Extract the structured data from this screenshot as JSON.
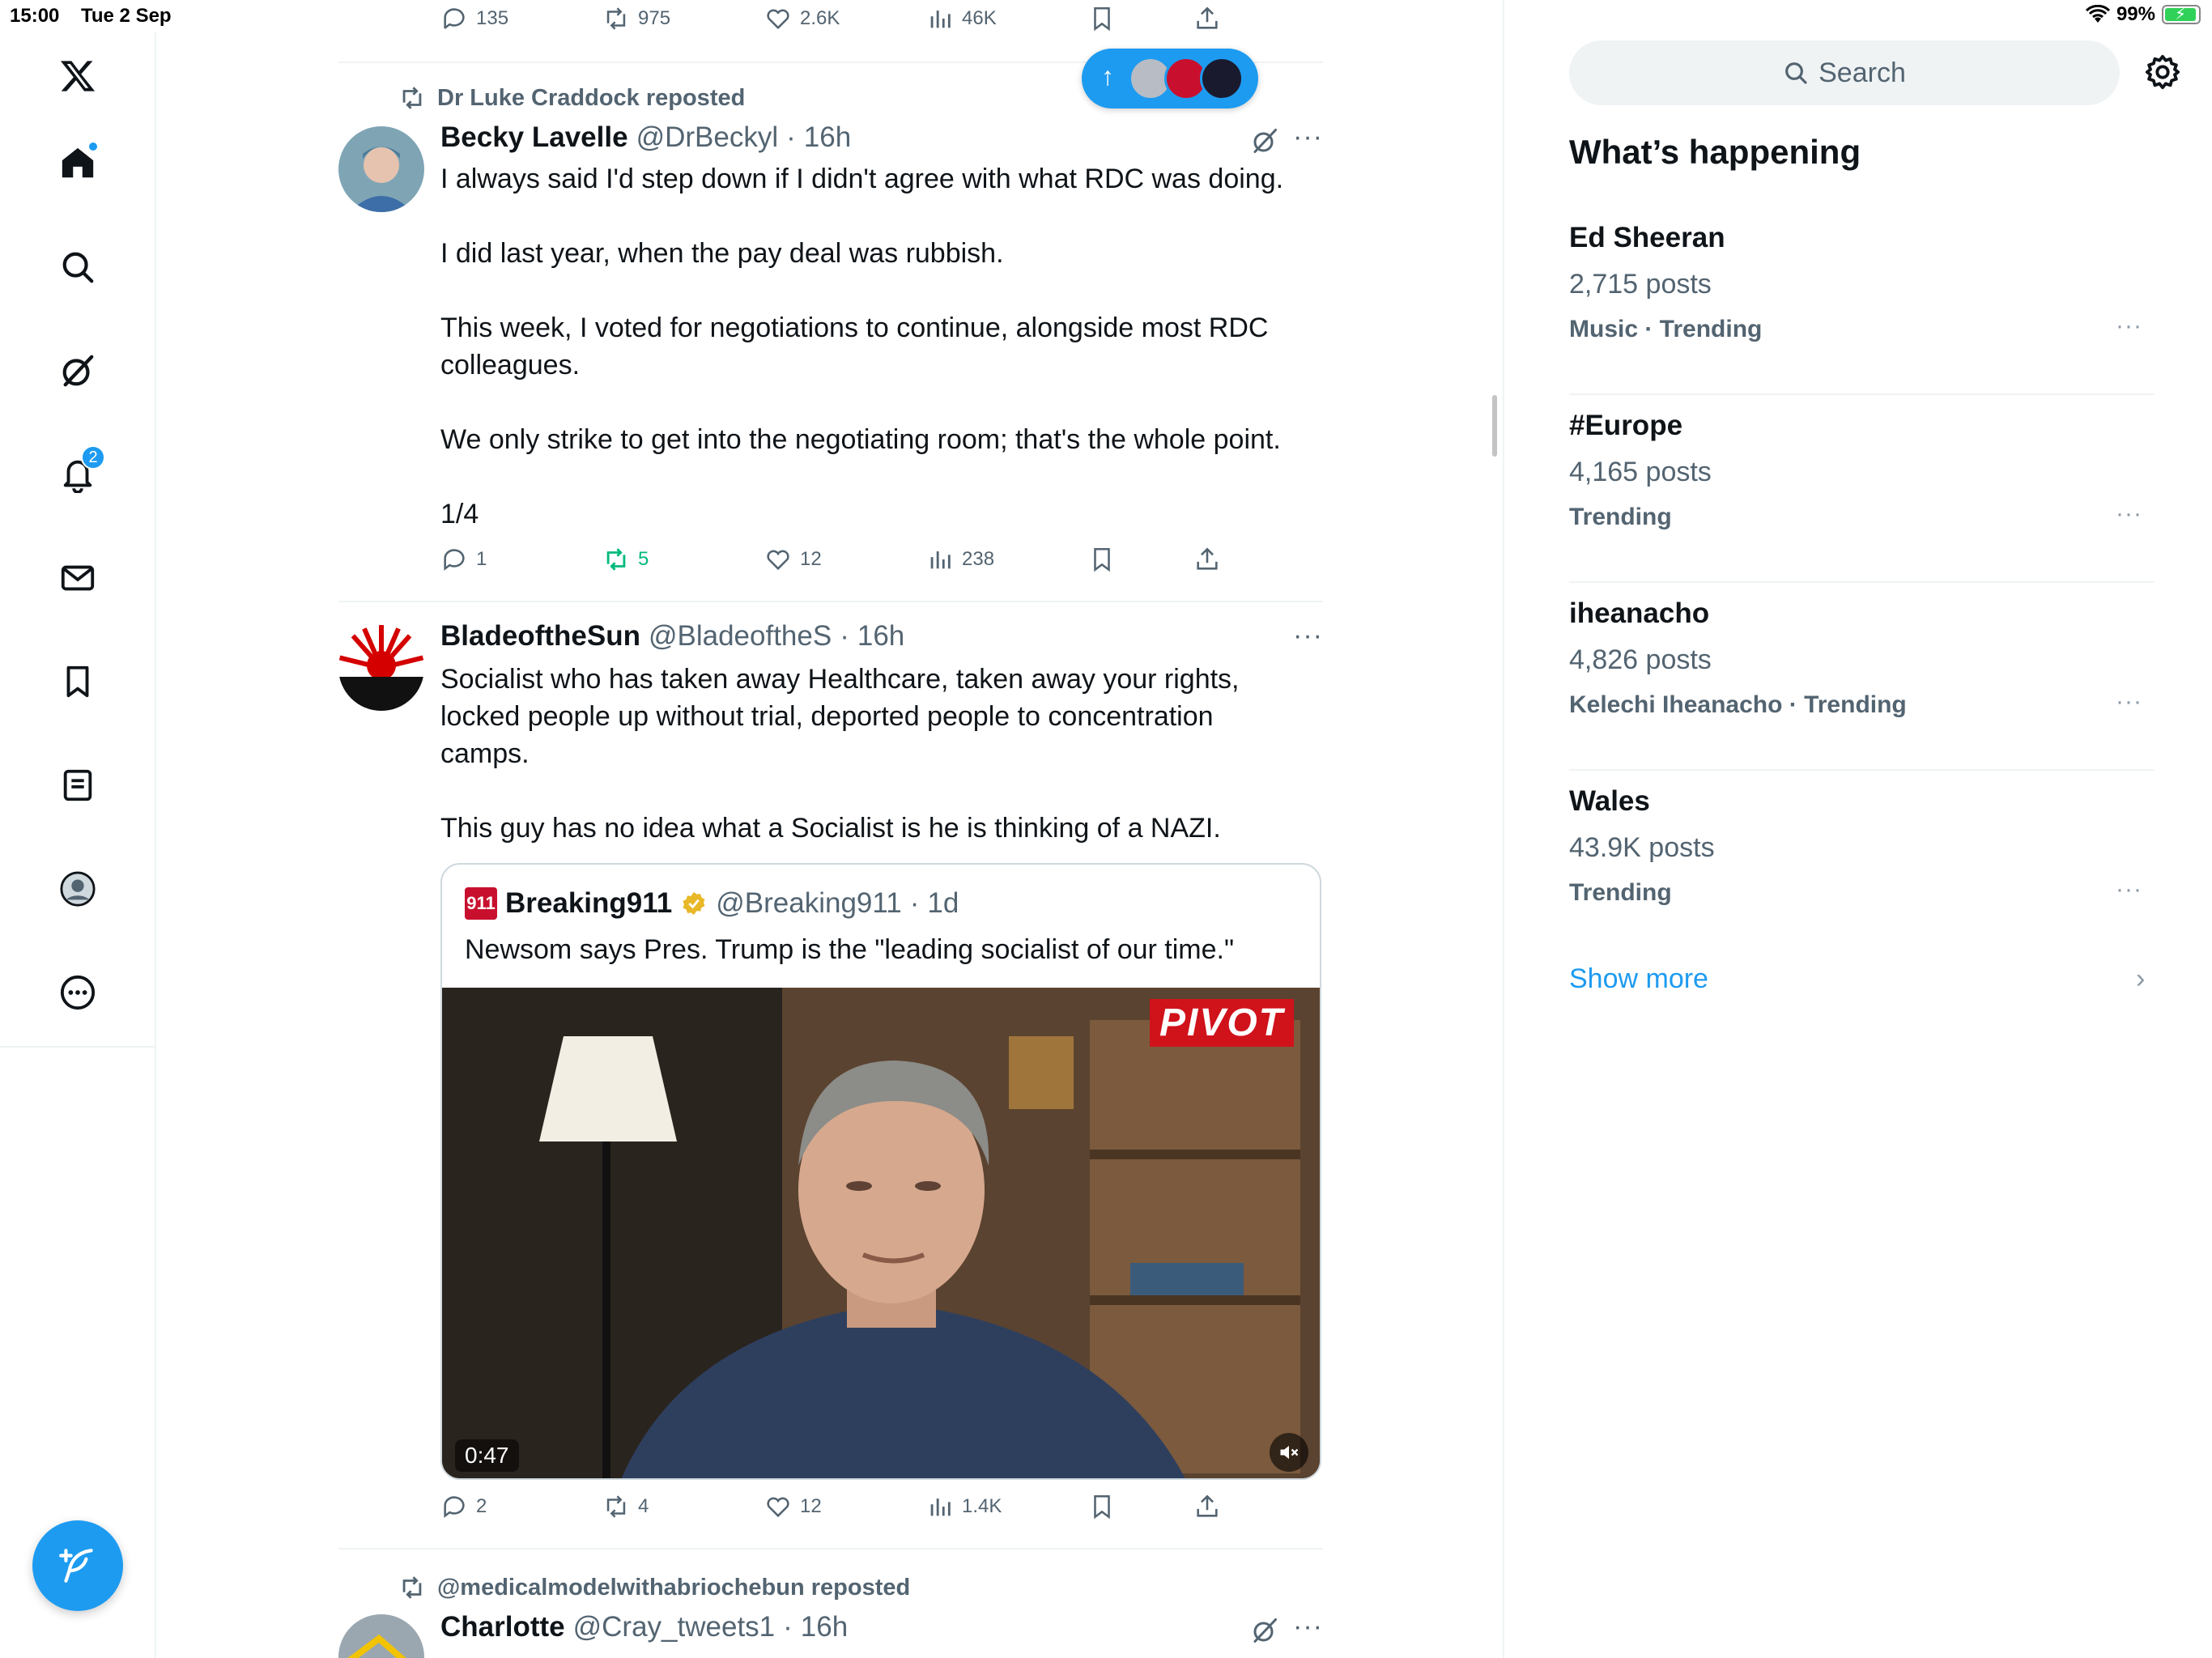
{
  "status_bar": {
    "time": "15:00",
    "date": "Tue 2 Sep",
    "battery": "99%"
  },
  "nav": {
    "notifications_badge": "2",
    "items": [
      "home",
      "explore",
      "grok",
      "notifications",
      "messages",
      "bookmarks",
      "lists",
      "profile",
      "more"
    ]
  },
  "feed": {
    "new_posts_pill_arrow": "↑",
    "top_actions": {
      "replies": "135",
      "reposts": "975",
      "likes": "2.6K",
      "views": "46K"
    },
    "post1": {
      "reposted_by": "Dr Luke Craddock reposted",
      "name": "Becky Lavelle",
      "handle": "@DrBeckyl",
      "dot": "·",
      "time": "16h",
      "text": "I always said I'd step down if I didn't agree with what RDC was doing.\n\nI did last year, when the pay deal was rubbish.\n\nThis week, I voted for negotiations to continue, alongside most RDC colleagues.\n\nWe only strike to get into the negotiating room; that's the whole point.\n\n1/4",
      "replies": "1",
      "reposts": "5",
      "likes": "12",
      "views": "238"
    },
    "post2": {
      "name": "BladeoftheSun",
      "handle": "@BladeoftheS",
      "dot": "·",
      "time": "16h",
      "text": "Socialist who has taken away Healthcare, taken away your rights,\nlocked people up without trial, deported people to concentration\ncamps.\n\nThis guy has no idea what a Socialist is he is thinking of a NAZI.",
      "quote": {
        "logo_text": "911",
        "name": "Breaking911",
        "handle": "@Breaking911",
        "dot": "·",
        "time": "1d",
        "text": "Newsom says Pres. Trump is the \"leading socialist of our time.\"",
        "video_brand": "PIVOT",
        "video_time": "0:47"
      },
      "replies": "2",
      "reposts": "4",
      "likes": "12",
      "views": "1.4K"
    },
    "post3": {
      "reposted_by": "@medicalmodelwithabriochebun reposted",
      "name": "Charlotte",
      "handle": "@Cray_tweets1",
      "dot": "·",
      "time": "16h"
    },
    "more_glyph": "···"
  },
  "sidebar": {
    "search_placeholder": "Search",
    "heading": "What’s happening",
    "trends": [
      {
        "name": "Ed Sheeran",
        "posts": "2,715 posts",
        "category": "Music · Trending"
      },
      {
        "name": "#Europe",
        "posts": "4,165 posts",
        "category": "Trending"
      },
      {
        "name": "iheanacho",
        "posts": "4,826 posts",
        "category": "Kelechi Iheanacho · Trending"
      },
      {
        "name": "Wales",
        "posts": "43.9K posts",
        "category": "Trending"
      }
    ],
    "show_more": "Show more",
    "chevron": "›"
  },
  "colors": {
    "accent": "#1d9bf0",
    "repost_green": "#00ba7c",
    "text": "#0f1419",
    "secondary": "#536471"
  }
}
